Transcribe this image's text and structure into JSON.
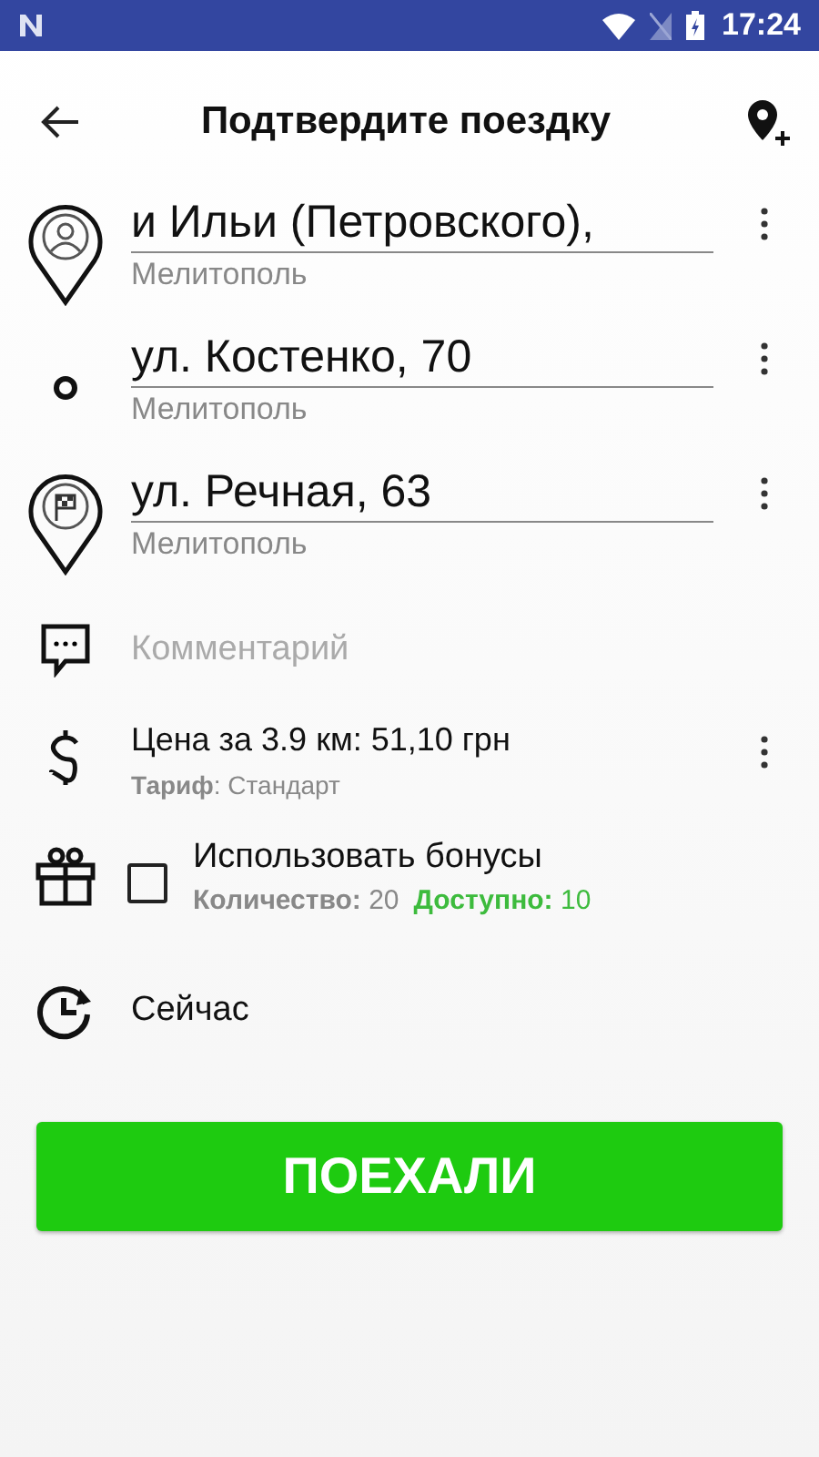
{
  "status_bar": {
    "time": "17:24"
  },
  "header": {
    "title": "Подтвердите поездку"
  },
  "stops": [
    {
      "kind": "start",
      "address": "и Ильи (Петровского),",
      "city": "Мелитополь"
    },
    {
      "kind": "via",
      "address": "ул. Костенко, 70",
      "city": "Мелитополь"
    },
    {
      "kind": "finish",
      "address": "ул. Речная, 63",
      "city": "Мелитополь"
    }
  ],
  "comment": {
    "placeholder": "Комментарий"
  },
  "price": {
    "text": "Цена за 3.9 км: 51,10 грн",
    "tariff": "**Тариф**: Стандарт"
  },
  "bonus": {
    "label": "Использовать бонусы",
    "checked": false,
    "count": "**Количество:** 20",
    "available": "**Доступно:** 10"
  },
  "time": {
    "text": "Сейчас"
  },
  "go_button": "ПОЕХАЛИ"
}
